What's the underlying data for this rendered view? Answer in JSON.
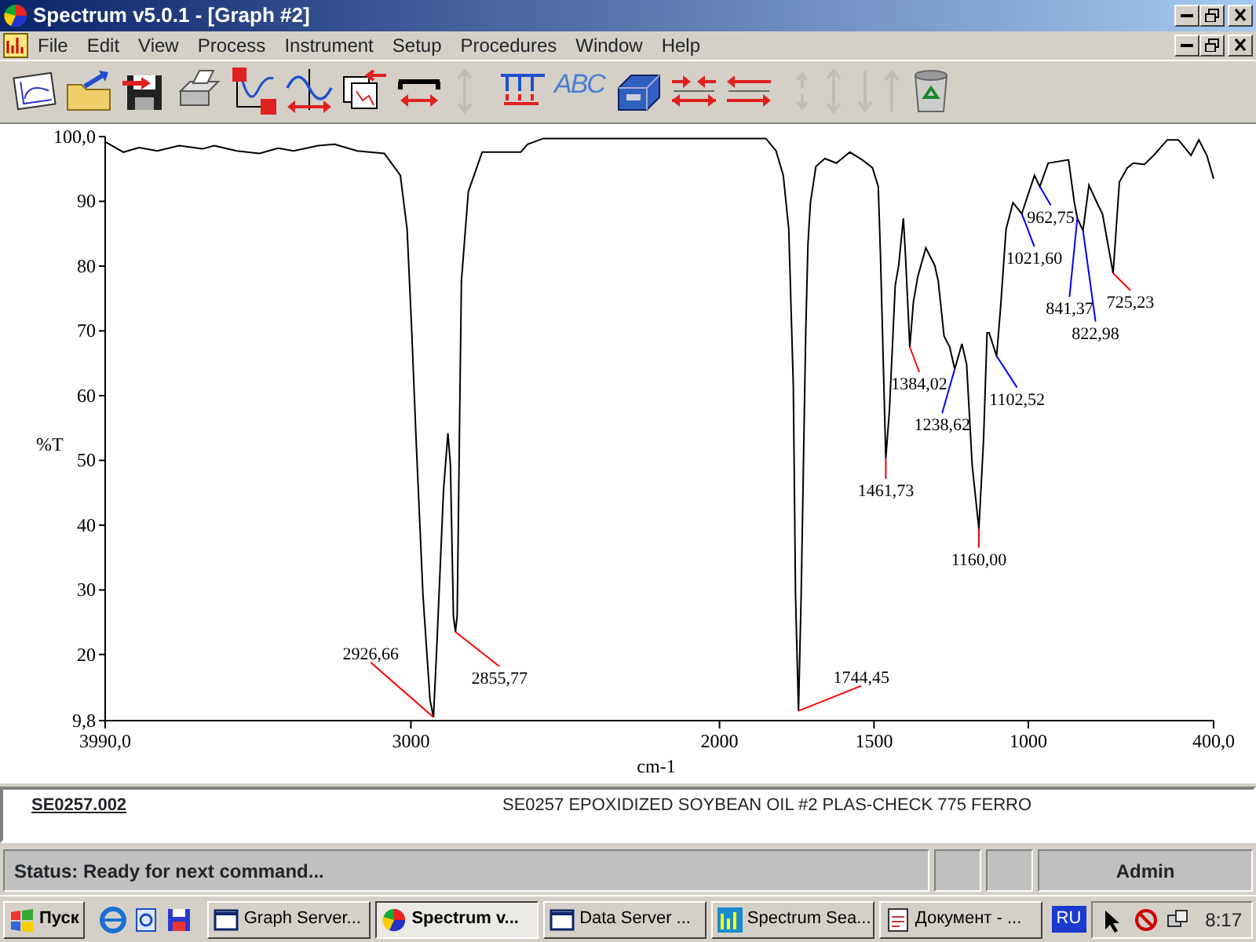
{
  "window": {
    "title": "Spectrum v5.0.1 - [Graph #2]"
  },
  "menu": [
    "File",
    "Edit",
    "View",
    "Process",
    "Instrument",
    "Setup",
    "Procedures",
    "Window",
    "Help"
  ],
  "toolbar": [
    {
      "kind": "chart-page",
      "disabled": false
    },
    {
      "kind": "folder",
      "disabled": false
    },
    {
      "kind": "disk",
      "disabled": false
    },
    {
      "kind": "printer",
      "disabled": false
    },
    {
      "kind": "axes",
      "disabled": false
    },
    {
      "kind": "wave-arrows",
      "disabled": false
    },
    {
      "kind": "windows",
      "disabled": false
    },
    {
      "kind": "scale-bar",
      "disabled": false
    },
    {
      "kind": "v-arrows",
      "disabled": true
    },
    {
      "kind": "peaks",
      "disabled": false
    },
    {
      "kind": "letters",
      "label": "ABC",
      "disabled": false
    },
    {
      "kind": "toolbox",
      "disabled": false
    },
    {
      "kind": "arrows-in",
      "disabled": false
    },
    {
      "kind": "arrows-swap",
      "disabled": false
    },
    {
      "kind": "v-arrows-small",
      "disabled": true
    },
    {
      "kind": "v-arrows",
      "disabled": true
    },
    {
      "kind": "down-arrow",
      "disabled": true
    },
    {
      "kind": "up-arrow",
      "disabled": true
    },
    {
      "kind": "trash",
      "disabled": false
    }
  ],
  "graph": {
    "chart_data": {
      "type": "line",
      "xlabel": "cm-1",
      "ylabel": "%T",
      "x": [
        3990,
        3931,
        3880,
        3821,
        3750,
        3674,
        3637,
        3564,
        3490,
        3430,
        3380,
        3300,
        3247,
        3174,
        3086,
        3034,
        3012,
        2997,
        2983,
        2961,
        2938,
        2926.66,
        2916,
        2894,
        2880,
        2872,
        2862,
        2855.77,
        2850,
        2843,
        2836,
        2814,
        2769,
        2644,
        2622,
        2571,
        1850,
        1817,
        1794,
        1776,
        1761,
        1754,
        1744.45,
        1736,
        1721,
        1714,
        1706,
        1688,
        1659,
        1622,
        1578,
        1538,
        1505,
        1486,
        1479,
        1468,
        1461.73,
        1450,
        1431,
        1420,
        1405,
        1398,
        1384.02,
        1372,
        1358,
        1332,
        1303,
        1292,
        1273,
        1255,
        1238.62,
        1215,
        1200,
        1182,
        1160,
        1145,
        1134,
        1127,
        1102.52,
        1090,
        1072,
        1050,
        1021.6,
        980,
        962.75,
        936,
        870,
        851,
        841.37,
        822.98,
        804,
        778,
        760,
        725.23,
        705,
        679,
        660,
        624,
        594,
        550,
        514,
        473,
        448,
        422,
        400
      ],
      "series": [
        {
          "color": "#000000",
          "values": [
            99.2,
            97.6,
            98.3,
            97.8,
            98.6,
            98.1,
            98.6,
            97.8,
            97.4,
            98.2,
            97.8,
            98.6,
            98.8,
            97.8,
            97.4,
            94,
            85.7,
            69.7,
            53.4,
            29.2,
            13,
            10.3,
            21.2,
            45.4,
            54.2,
            49.3,
            26,
            23.5,
            26,
            53.4,
            77.7,
            91.5,
            97.6,
            97.6,
            98.8,
            99.7,
            99.7,
            97.8,
            94,
            85.7,
            61.5,
            29.2,
            11.3,
            29.2,
            69.7,
            83.3,
            89.8,
            95.4,
            96.6,
            95.9,
            97.6,
            96.4,
            95.2,
            92.3,
            81.8,
            61.5,
            50.3,
            57.6,
            77,
            80.1,
            87.4,
            81.8,
            67.5,
            74.5,
            78.4,
            82.8,
            80.1,
            77.7,
            69.2,
            67.5,
            64.1,
            68,
            64.8,
            49.3,
            39.4,
            53.4,
            69.7,
            69.7,
            66.1,
            73.6,
            85.7,
            89.8,
            88.1,
            94,
            92.3,
            95.9,
            96.4,
            89.8,
            87.4,
            85.5,
            92.5,
            89.8,
            88.1,
            78.9,
            93,
            95.2,
            95.9,
            95.7,
            97.1,
            99.5,
            99.5,
            97.1,
            99.5,
            97.1,
            93.5
          ]
        }
      ],
      "xlim": [
        3990,
        400
      ],
      "ylim": [
        9.8,
        100
      ],
      "xticks": [
        {
          "value": 3990,
          "label": "3990,0"
        },
        3000,
        2000,
        1500,
        1000,
        {
          "value": 400,
          "label": "400,0"
        }
      ],
      "yticks": [
        {
          "value": 100,
          "label": "100,0"
        },
        90,
        80,
        70,
        60,
        50,
        40,
        30,
        20,
        {
          "value": 9.8,
          "label": "9,8"
        }
      ],
      "annotations": [
        {
          "text": "2926,66",
          "x": 2926.66,
          "y": 10.3
        },
        {
          "text": "2855,77",
          "x": 2855.77,
          "y": 23.5
        },
        {
          "text": "1744,45",
          "x": 1744.45,
          "y": 11.3
        },
        {
          "text": "1461,73",
          "x": 1461.73,
          "y": 50.3
        },
        {
          "text": "1384,02",
          "x": 1384.02,
          "y": 67.5
        },
        {
          "text": "1238,62",
          "x": 1238.62,
          "y": 64.1
        },
        {
          "text": "1160,00",
          "x": 1160,
          "y": 39.4
        },
        {
          "text": "1102,52",
          "x": 1102.52,
          "y": 66.1
        },
        {
          "text": "1021,60",
          "x": 1021.6,
          "y": 88.1
        },
        {
          "text": "962,75",
          "x": 962.75,
          "y": 92.3
        },
        {
          "text": "841,37",
          "x": 841.37,
          "y": 87.4
        },
        {
          "text": "822,98",
          "x": 822.98,
          "y": 85.5
        },
        {
          "text": "725,23",
          "x": 725.23,
          "y": 78.9
        }
      ]
    }
  },
  "sample": {
    "id": "SE0257.002",
    "description": "SE0257 EPOXIDIZED SOYBEAN OIL #2 PLAS-CHECK 775 FERRO"
  },
  "status_bar": {
    "message": "Status: Ready for next command...",
    "user": "Admin"
  },
  "taskbar": {
    "start": "Пуск",
    "tasks": [
      {
        "label": "Graph Server...",
        "selected": false
      },
      {
        "label": "Spectrum v...",
        "selected": true
      },
      {
        "label": "Data Server ...",
        "selected": false
      },
      {
        "label": "Spectrum Sea...",
        "selected": false
      },
      {
        "label": "Документ - ...",
        "selected": false
      }
    ],
    "language": "RU",
    "clock": "8:17"
  }
}
